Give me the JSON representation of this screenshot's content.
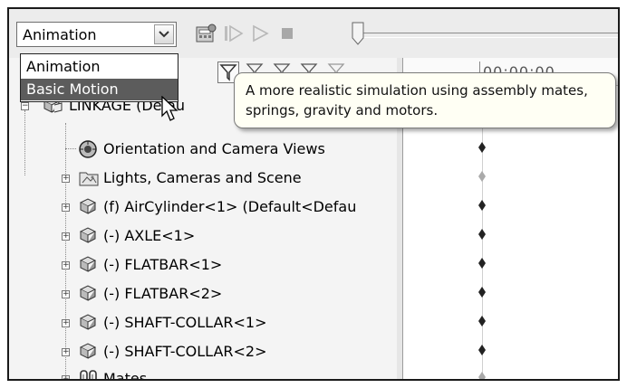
{
  "toolbar": {
    "study_type_value": "Animation",
    "icons": [
      "calculator-icon",
      "play-from-start-icon",
      "play-icon",
      "stop-icon",
      "timeline-slider"
    ]
  },
  "dropdown": {
    "options": [
      "Animation",
      "Basic Motion"
    ],
    "selected": "Basic Motion"
  },
  "tooltip": {
    "text": "A more realistic simulation using assembly mates, springs, gravity and motors."
  },
  "timeline": {
    "time_header": "00:00:00"
  },
  "tree": {
    "root_label": "LINKAGE (Defau",
    "items": [
      {
        "label": "Orientation and Camera Views",
        "icon": "camera-views-icon"
      },
      {
        "label": "Lights, Cameras and Scene",
        "icon": "lights-scene-icon"
      },
      {
        "label": "(f) AirCylinder<1> (Default<Defau",
        "icon": "part-icon"
      },
      {
        "label": "(-) AXLE<1>",
        "icon": "part-icon"
      },
      {
        "label": "(-) FLATBAR<1>",
        "icon": "part-icon"
      },
      {
        "label": "(-) FLATBAR<2>",
        "icon": "part-icon"
      },
      {
        "label": "(-) SHAFT-COLLAR<1>",
        "icon": "part-icon"
      },
      {
        "label": "(-) SHAFT-COLLAR<2>",
        "icon": "part-icon"
      },
      {
        "label": "Mates",
        "icon": "mates-icon"
      }
    ]
  }
}
